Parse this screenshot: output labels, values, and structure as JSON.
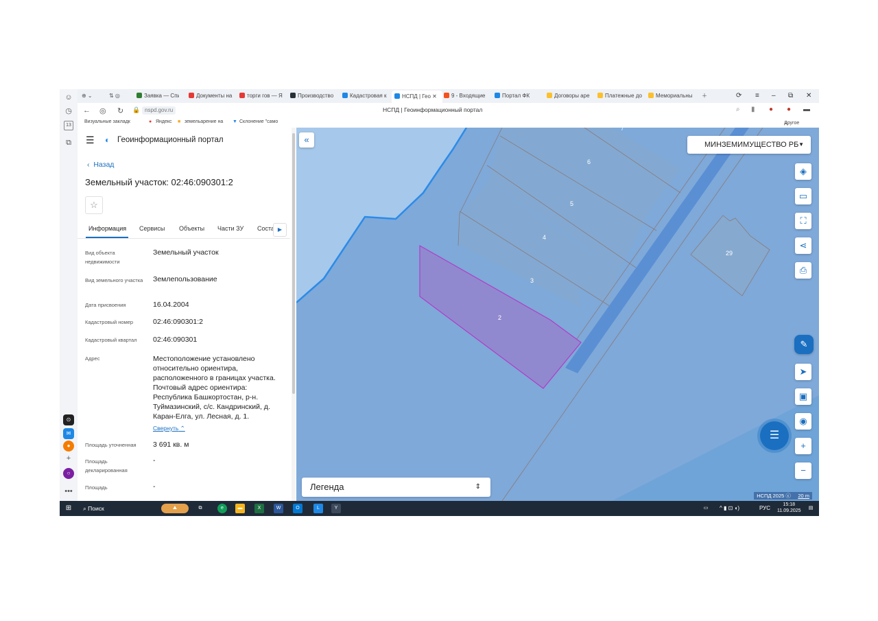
{
  "browser": {
    "tabs": [
      {
        "label": "Заявка — Спи",
        "color": "#2e7d32"
      },
      {
        "label": "Документы на",
        "color": "#e53935"
      },
      {
        "label": "торги гов — Я",
        "color": "#e53935"
      },
      {
        "label": "Производство",
        "color": "#263238"
      },
      {
        "label": "Кадастровая к",
        "color": "#1e88e5"
      },
      {
        "label": "НСПД | Гео",
        "color": "#1e88e5",
        "active": true
      },
      {
        "label": "9 - Входящие",
        "color": "#f4511e"
      },
      {
        "label": "Портал ФК",
        "color": "#1e88e5"
      },
      {
        "label": "Договоры аре",
        "color": "#fbc02d"
      },
      {
        "label": "Платежные до",
        "color": "#fbc02d"
      },
      {
        "label": "Мемориальны",
        "color": "#fbc02d"
      }
    ],
    "url": "nspd.gov.ru",
    "page_title": "НСПД | Геоинформационный портал",
    "bookmarks": [
      "Визуальные закладк",
      "Яндекс",
      "земельарение на",
      "Склонение \"само"
    ],
    "other_bookmarks": "Другое"
  },
  "panel": {
    "portal_title": "Геоинформационный портал",
    "back_label": "Назад",
    "object_title": "Земельный участок: 02:46:090301:2",
    "star": "☆",
    "tabs": [
      "Информация",
      "Сервисы",
      "Объекты",
      "Части ЗУ",
      "Соста"
    ],
    "fields": [
      {
        "label": "Вид объекта недвижимости",
        "value": "Земельный участок"
      },
      {
        "label": "Вид земельного участка",
        "value": "Землепользование"
      },
      {
        "label": "Дата присвоения",
        "value": "16.04.2004"
      },
      {
        "label": "Кадастровый номер",
        "value": "02:46:090301:2"
      },
      {
        "label": "Кадастровый квартал",
        "value": "02:46:090301"
      },
      {
        "label": "Адрес",
        "value": "Местоположение установлено относительно ориентира, расположенного в границах участка. Почтовый адрес ориентира: Республика Башкортостан, р-н. Туймазинский, с/с. Кандринский, д. Каран-Елга, ул. Лесная, д. 1."
      },
      {
        "label": "Площадь уточненная",
        "value": "3 691 кв. м"
      },
      {
        "label": "Площадь декларированная",
        "value": "-"
      },
      {
        "label": "Площадь",
        "value": "-"
      }
    ],
    "collapse_label": "Свернуть"
  },
  "map": {
    "region_select": "МИНЗЕМИМУЩЕСТВО РБ",
    "legend": "Легенда",
    "copyright": "НСПД 2025",
    "scale": "20 m",
    "parcel_labels": [
      "2",
      "3",
      "4",
      "5",
      "6",
      "29"
    ]
  },
  "taskbar": {
    "search": "Поиск",
    "lang": "РУС",
    "time": "15:18",
    "date": "11.09.2025"
  }
}
